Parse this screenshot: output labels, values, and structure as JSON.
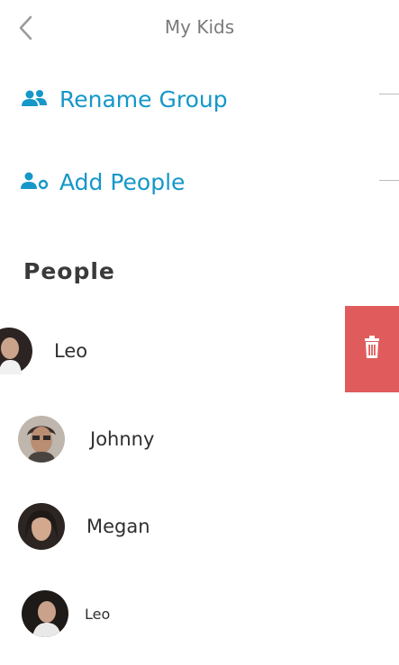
{
  "header": {
    "title": "My Kids"
  },
  "actions": [
    {
      "label": "Rename Group",
      "icon": "group-icon"
    },
    {
      "label": "Add People",
      "icon": "add-person-icon"
    }
  ],
  "people_section": {
    "heading": "People"
  },
  "people": [
    {
      "name": "Leo"
    },
    {
      "name": "Johnny"
    },
    {
      "name": "Megan"
    },
    {
      "name": "Leo"
    }
  ],
  "delete": {
    "icon": "trash-icon",
    "color": "#e05b5b"
  },
  "colors": {
    "accent": "#1597c9",
    "delete": "#e05b5b",
    "title": "#7a7a7a"
  }
}
